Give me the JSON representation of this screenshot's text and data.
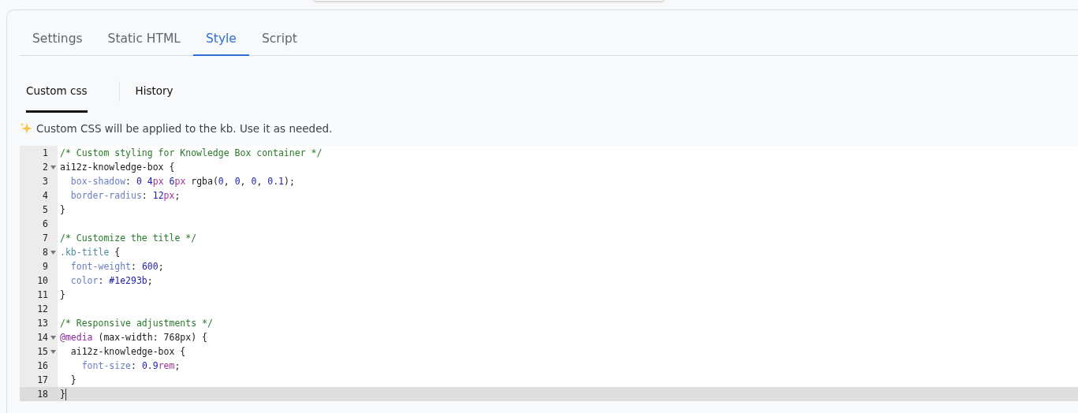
{
  "tabs": [
    {
      "label": "Settings",
      "selected": false
    },
    {
      "label": "Static HTML",
      "selected": false
    },
    {
      "label": "Style",
      "selected": true
    },
    {
      "label": "Script",
      "selected": false
    }
  ],
  "subtabs": [
    {
      "label": "Custom css",
      "selected": true
    },
    {
      "label": "History",
      "selected": false
    }
  ],
  "note": "Custom CSS will be applied to the kb. Use it as needed.",
  "editor": {
    "lines": [
      {
        "number": "1",
        "foldable": false,
        "active": false,
        "tokens": [
          {
            "kind": "comment",
            "text": "/* Custom styling for Knowledge Box container */"
          }
        ]
      },
      {
        "number": "2",
        "foldable": true,
        "active": false,
        "tokens": [
          {
            "kind": "tag",
            "text": "ai12z-knowledge-box"
          },
          {
            "kind": "plain",
            "text": " {"
          }
        ]
      },
      {
        "number": "3",
        "foldable": false,
        "active": false,
        "tokens": [
          {
            "kind": "property",
            "text": "  box-shadow"
          },
          {
            "kind": "plain",
            "text": ": "
          },
          {
            "kind": "number",
            "text": "0 4"
          },
          {
            "kind": "unit",
            "text": "px"
          },
          {
            "kind": "number",
            "text": " 6"
          },
          {
            "kind": "unit",
            "text": "px"
          },
          {
            "kind": "plain",
            "text": " rgba("
          },
          {
            "kind": "number",
            "text": "0"
          },
          {
            "kind": "plain",
            "text": ", "
          },
          {
            "kind": "number",
            "text": "0"
          },
          {
            "kind": "plain",
            "text": ", "
          },
          {
            "kind": "number",
            "text": "0"
          },
          {
            "kind": "plain",
            "text": ", "
          },
          {
            "kind": "number",
            "text": "0.1"
          },
          {
            "kind": "plain",
            "text": ");"
          }
        ]
      },
      {
        "number": "4",
        "foldable": false,
        "active": false,
        "tokens": [
          {
            "kind": "property",
            "text": "  border-radius"
          },
          {
            "kind": "plain",
            "text": ": "
          },
          {
            "kind": "number",
            "text": "12"
          },
          {
            "kind": "unit",
            "text": "px"
          },
          {
            "kind": "plain",
            "text": ";"
          }
        ]
      },
      {
        "number": "5",
        "foldable": false,
        "active": false,
        "tokens": [
          {
            "kind": "plain",
            "text": "}"
          }
        ]
      },
      {
        "number": "6",
        "foldable": false,
        "active": false
      },
      {
        "number": "7",
        "foldable": false,
        "active": false,
        "tokens": [
          {
            "kind": "comment",
            "text": "/* Customize the title */"
          }
        ]
      },
      {
        "number": "8",
        "foldable": true,
        "active": false,
        "tokens": [
          {
            "kind": "class",
            "text": ".kb-title"
          },
          {
            "kind": "plain",
            "text": " {"
          }
        ]
      },
      {
        "number": "9",
        "foldable": false,
        "active": false,
        "tokens": [
          {
            "kind": "property",
            "text": "  font-weight"
          },
          {
            "kind": "plain",
            "text": ": "
          },
          {
            "kind": "number",
            "text": "600"
          },
          {
            "kind": "plain",
            "text": ";"
          }
        ]
      },
      {
        "number": "10",
        "foldable": false,
        "active": false,
        "tokens": [
          {
            "kind": "property",
            "text": "  color"
          },
          {
            "kind": "plain",
            "text": ": "
          },
          {
            "kind": "number",
            "text": "#1e293b"
          },
          {
            "kind": "plain",
            "text": ";"
          }
        ]
      },
      {
        "number": "11",
        "foldable": false,
        "active": false,
        "tokens": [
          {
            "kind": "plain",
            "text": "}"
          }
        ]
      },
      {
        "number": "12",
        "foldable": false,
        "active": false
      },
      {
        "number": "13",
        "foldable": false,
        "active": false,
        "tokens": [
          {
            "kind": "comment",
            "text": "/* Responsive adjustments */"
          }
        ]
      },
      {
        "number": "14",
        "foldable": true,
        "active": false,
        "tokens": [
          {
            "kind": "atrule",
            "text": "@media"
          },
          {
            "kind": "plain",
            "text": " (max-width: 768px) {"
          }
        ]
      },
      {
        "number": "15",
        "foldable": true,
        "active": false,
        "tokens": [
          {
            "kind": "tag",
            "text": "  ai12z-knowledge-box"
          },
          {
            "kind": "plain",
            "text": " {"
          }
        ]
      },
      {
        "number": "16",
        "foldable": false,
        "active": false,
        "tokens": [
          {
            "kind": "property",
            "text": "    font-size"
          },
          {
            "kind": "plain",
            "text": ": "
          },
          {
            "kind": "number",
            "text": "0.9"
          },
          {
            "kind": "unit",
            "text": "rem"
          },
          {
            "kind": "plain",
            "text": ";"
          }
        ]
      },
      {
        "number": "17",
        "foldable": false,
        "active": false,
        "tokens": [
          {
            "kind": "plain",
            "text": "  }"
          }
        ]
      },
      {
        "number": "18",
        "foldable": false,
        "active": true,
        "tokens": [
          {
            "kind": "plain",
            "text": "}"
          }
        ]
      }
    ]
  }
}
